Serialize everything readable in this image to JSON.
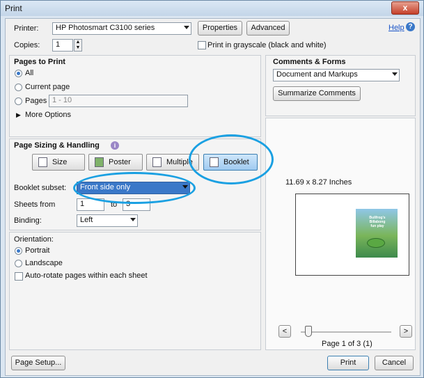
{
  "window": {
    "title": "Print",
    "close": "x"
  },
  "header": {
    "printer_label": "Printer:",
    "printer_value": "HP Photosmart C3100 series",
    "properties": "Properties",
    "advanced": "Advanced",
    "help": "Help",
    "help_icon": "?",
    "copies_label": "Copies:",
    "copies_value": "1",
    "grayscale_label": "Print in grayscale (black and white)"
  },
  "pages": {
    "title": "Pages to Print",
    "all": "All",
    "current": "Current page",
    "pages": "Pages",
    "pages_value": "1 - 10",
    "more": "More Options",
    "selected": "All"
  },
  "sizing": {
    "title": "Page Sizing & Handling",
    "info_icon": "i",
    "buttons": [
      "Size",
      "Poster",
      "Multiple",
      "Booklet"
    ],
    "selected": "Booklet",
    "subset_label": "Booklet subset:",
    "subset_value": "Front side only",
    "sheets_label": "Sheets from",
    "sheets_from": "1",
    "to_label": "to",
    "sheets_to": "3",
    "binding_label": "Binding:",
    "binding_value": "Left"
  },
  "orientation": {
    "title": "Orientation:",
    "portrait": "Portrait",
    "landscape": "Landscape",
    "autorotate": "Auto-rotate pages within each sheet",
    "selected": "Portrait"
  },
  "comments": {
    "title": "Comments & Forms",
    "value": "Document and Markups",
    "summarize": "Summarize Comments"
  },
  "preview": {
    "size": "11.69 x 8.27 Inches",
    "thumb_text": [
      "Bullfrog's",
      "Billabong",
      "fun play"
    ],
    "prev": "<",
    "next": ">",
    "page": "Page 1 of 3 (1)"
  },
  "footer": {
    "page_setup": "Page Setup...",
    "print": "Print",
    "cancel": "Cancel"
  },
  "colors": {
    "highlight": "#1aa0e2",
    "selection": "#3a78c8",
    "link": "#1a55c8"
  }
}
